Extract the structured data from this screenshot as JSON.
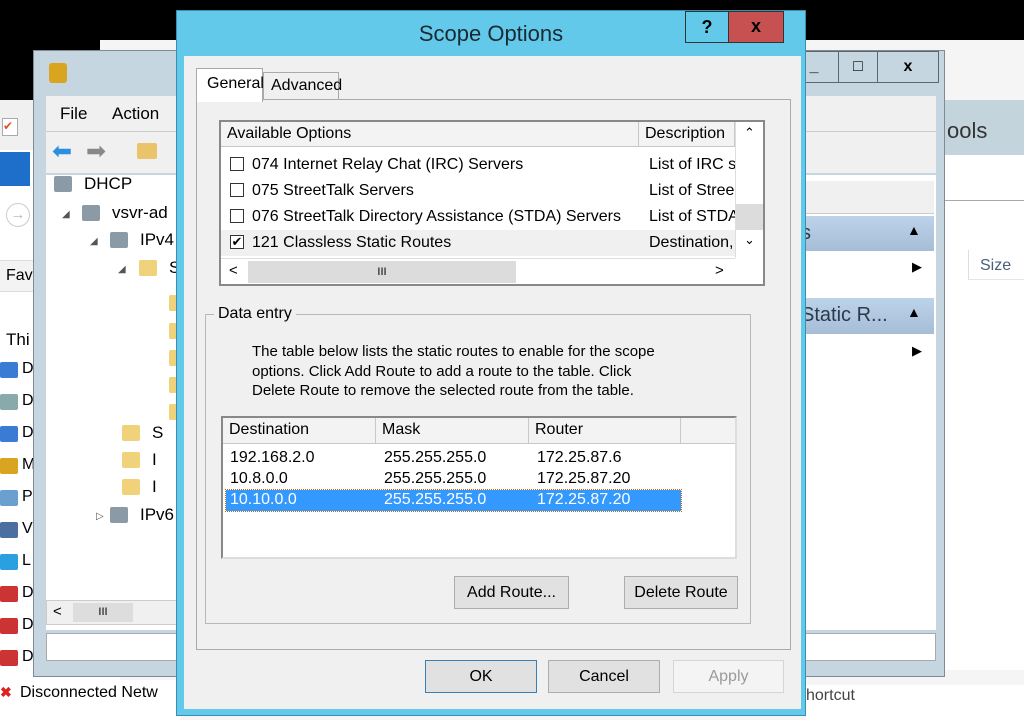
{
  "explorer": {
    "ribbon_tab": "Fav",
    "section": "Thi",
    "items": [
      "D",
      "D",
      "D",
      "M",
      "P",
      "V",
      "L",
      "D",
      "D",
      "D",
      "Disconnected Netw"
    ],
    "right_title": "ools",
    "column_size": "Size",
    "shortcut_text": "hortcut"
  },
  "mmc": {
    "menu": [
      "File",
      "Action"
    ],
    "tree": [
      {
        "label": "DHCP"
      },
      {
        "label": "vsvr-ad"
      },
      {
        "label": "IPv4"
      },
      {
        "label": "S"
      },
      {
        "label": "S"
      },
      {
        "label": "I"
      },
      {
        "label": "I"
      },
      {
        "label": "IPv6"
      }
    ],
    "actions": {
      "section1": "s",
      "section2": "Static R..."
    },
    "window_buttons": {
      "minimize": "_",
      "maximize": "□",
      "close": "x"
    }
  },
  "dialog": {
    "title": "Scope Options",
    "help": "?",
    "close": "x",
    "tabs": [
      {
        "label": "General",
        "active": true
      },
      {
        "label": "Advanced",
        "active": false
      }
    ],
    "options_list": {
      "columns": [
        "Available Options",
        "Description"
      ],
      "rows": [
        {
          "checked": false,
          "option": "074 Internet Relay Chat (IRC) Servers",
          "description": "List of IRC s"
        },
        {
          "checked": false,
          "option": "075 StreetTalk Servers",
          "description": "List of Stree"
        },
        {
          "checked": false,
          "option": "076 StreetTalk Directory Assistance (STDA) Servers",
          "description": "List of STDA"
        },
        {
          "checked": true,
          "option": "121 Classless Static Routes",
          "description": "Destination,"
        }
      ]
    },
    "data_entry": {
      "legend": "Data entry",
      "instructions": [
        "The table below lists the static routes to enable for the scope",
        "options.  Click Add Route to add a route to the table.  Click",
        "Delete Route to remove the selected route from the table."
      ],
      "columns": [
        "Destination",
        "Mask",
        "Router"
      ],
      "routes": [
        {
          "destination": "192.168.2.0",
          "mask": "255.255.255.0",
          "router": "172.25.87.6",
          "selected": false
        },
        {
          "destination": "10.8.0.0",
          "mask": "255.255.255.0",
          "router": "172.25.87.20",
          "selected": false
        },
        {
          "destination": "10.10.0.0",
          "mask": "255.255.255.0",
          "router": "172.25.87.20",
          "selected": true
        }
      ],
      "add_route": "Add Route...",
      "delete_route": "Delete Route"
    },
    "ok": "OK",
    "cancel": "Cancel",
    "apply": "Apply",
    "selection_color": "#3399FF",
    "frame_color": "#63C9EA",
    "close_color": "#C75050"
  }
}
